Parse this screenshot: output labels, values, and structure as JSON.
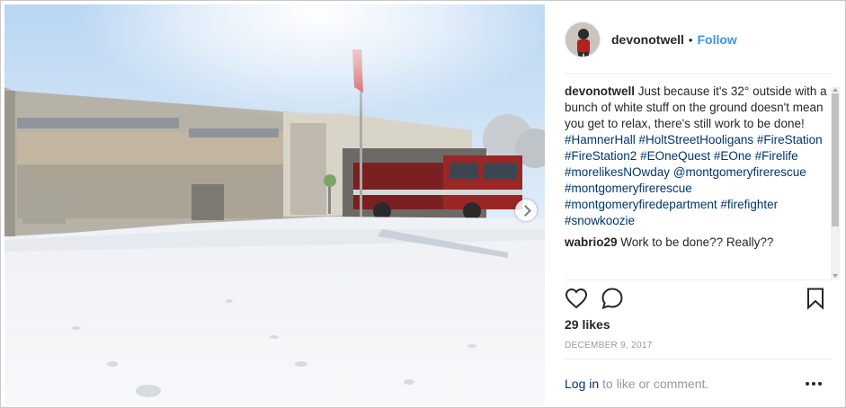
{
  "post": {
    "username": "devonotwell",
    "separator": "•",
    "follow_label": "Follow",
    "photo": {
      "description_icon": "photo-icon",
      "next_icon": "chevron-right-icon"
    },
    "caption": {
      "username": "devonotwell",
      "text": "Just because it's 32° outside with a bunch of white stuff on the ground doesn't mean you get to relax, there's still work to be done!",
      "hashtags": [
        "#HamnerHall",
        "#HoltStreetHooligans",
        "#FireStation",
        "#FireStation2",
        "#EOneQuest",
        "#EOne",
        "#Firelife",
        "#morelikesNOwday",
        "@montgomeryfirerescue",
        "#montgomeryfirerescue",
        "#montgomeryfiredepartment",
        "#firefighter",
        "#snowkoozie"
      ]
    },
    "comment": {
      "username": "wabrio29",
      "text": "Work to be done?? Really??"
    },
    "actions": {
      "like_icon": "heart-icon",
      "comment_icon": "comment-icon",
      "save_icon": "bookmark-icon"
    },
    "likes_text": "29 likes",
    "date_text": "DECEMBER 9, 2017",
    "login": {
      "link_text": "Log in",
      "rest_text": " to like or comment."
    },
    "more_icon": "more-options-icon"
  }
}
